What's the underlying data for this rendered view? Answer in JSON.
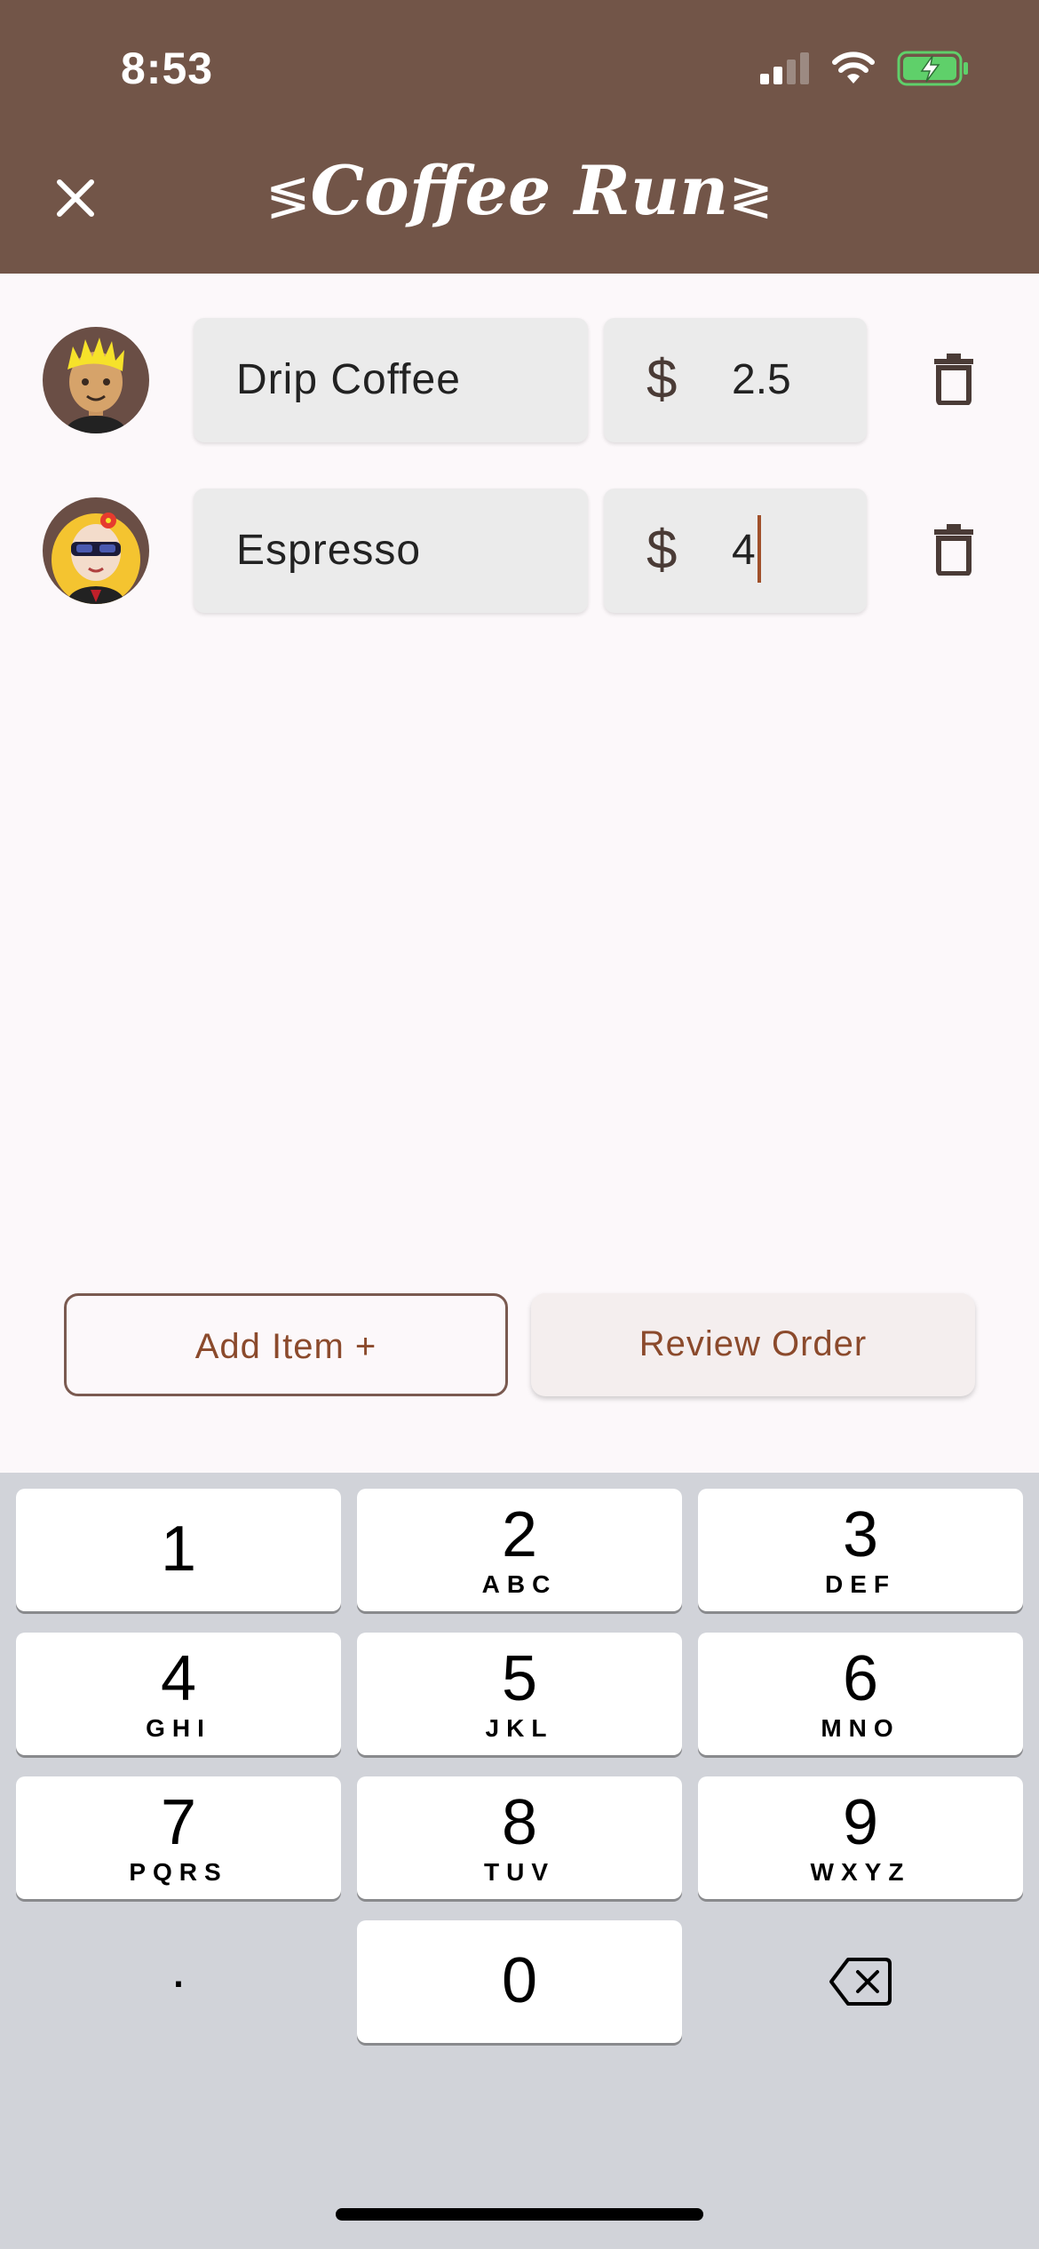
{
  "status_bar": {
    "time": "8:53"
  },
  "header": {
    "title": "Coffee Run",
    "title_deco_left": "≶",
    "title_deco_right": "≷"
  },
  "items": [
    {
      "name": "Drip Coffee",
      "currency": "$",
      "price": "2.5"
    },
    {
      "name": "Espresso",
      "currency": "$",
      "price": "4"
    }
  ],
  "buttons": {
    "add_item": "Add Item +",
    "review_order": "Review Order"
  },
  "keyboard": {
    "keys": [
      {
        "num": "1",
        "letters": ""
      },
      {
        "num": "2",
        "letters": "ABC"
      },
      {
        "num": "3",
        "letters": "DEF"
      },
      {
        "num": "4",
        "letters": "GHI"
      },
      {
        "num": "5",
        "letters": "JKL"
      },
      {
        "num": "6",
        "letters": "MNO"
      },
      {
        "num": "7",
        "letters": "PQRS"
      },
      {
        "num": "8",
        "letters": "TUV"
      },
      {
        "num": "9",
        "letters": "WXYZ"
      },
      {
        "num": "0",
        "letters": ""
      }
    ],
    "dot": "."
  },
  "colors": {
    "header_bg": "#725548",
    "accent": "#8b4a2c",
    "keyboard_bg": "#d1d3d9"
  },
  "icons": [
    "signal-icon",
    "wifi-icon",
    "battery-charging-icon",
    "close-icon",
    "trash-icon",
    "backspace-icon"
  ]
}
